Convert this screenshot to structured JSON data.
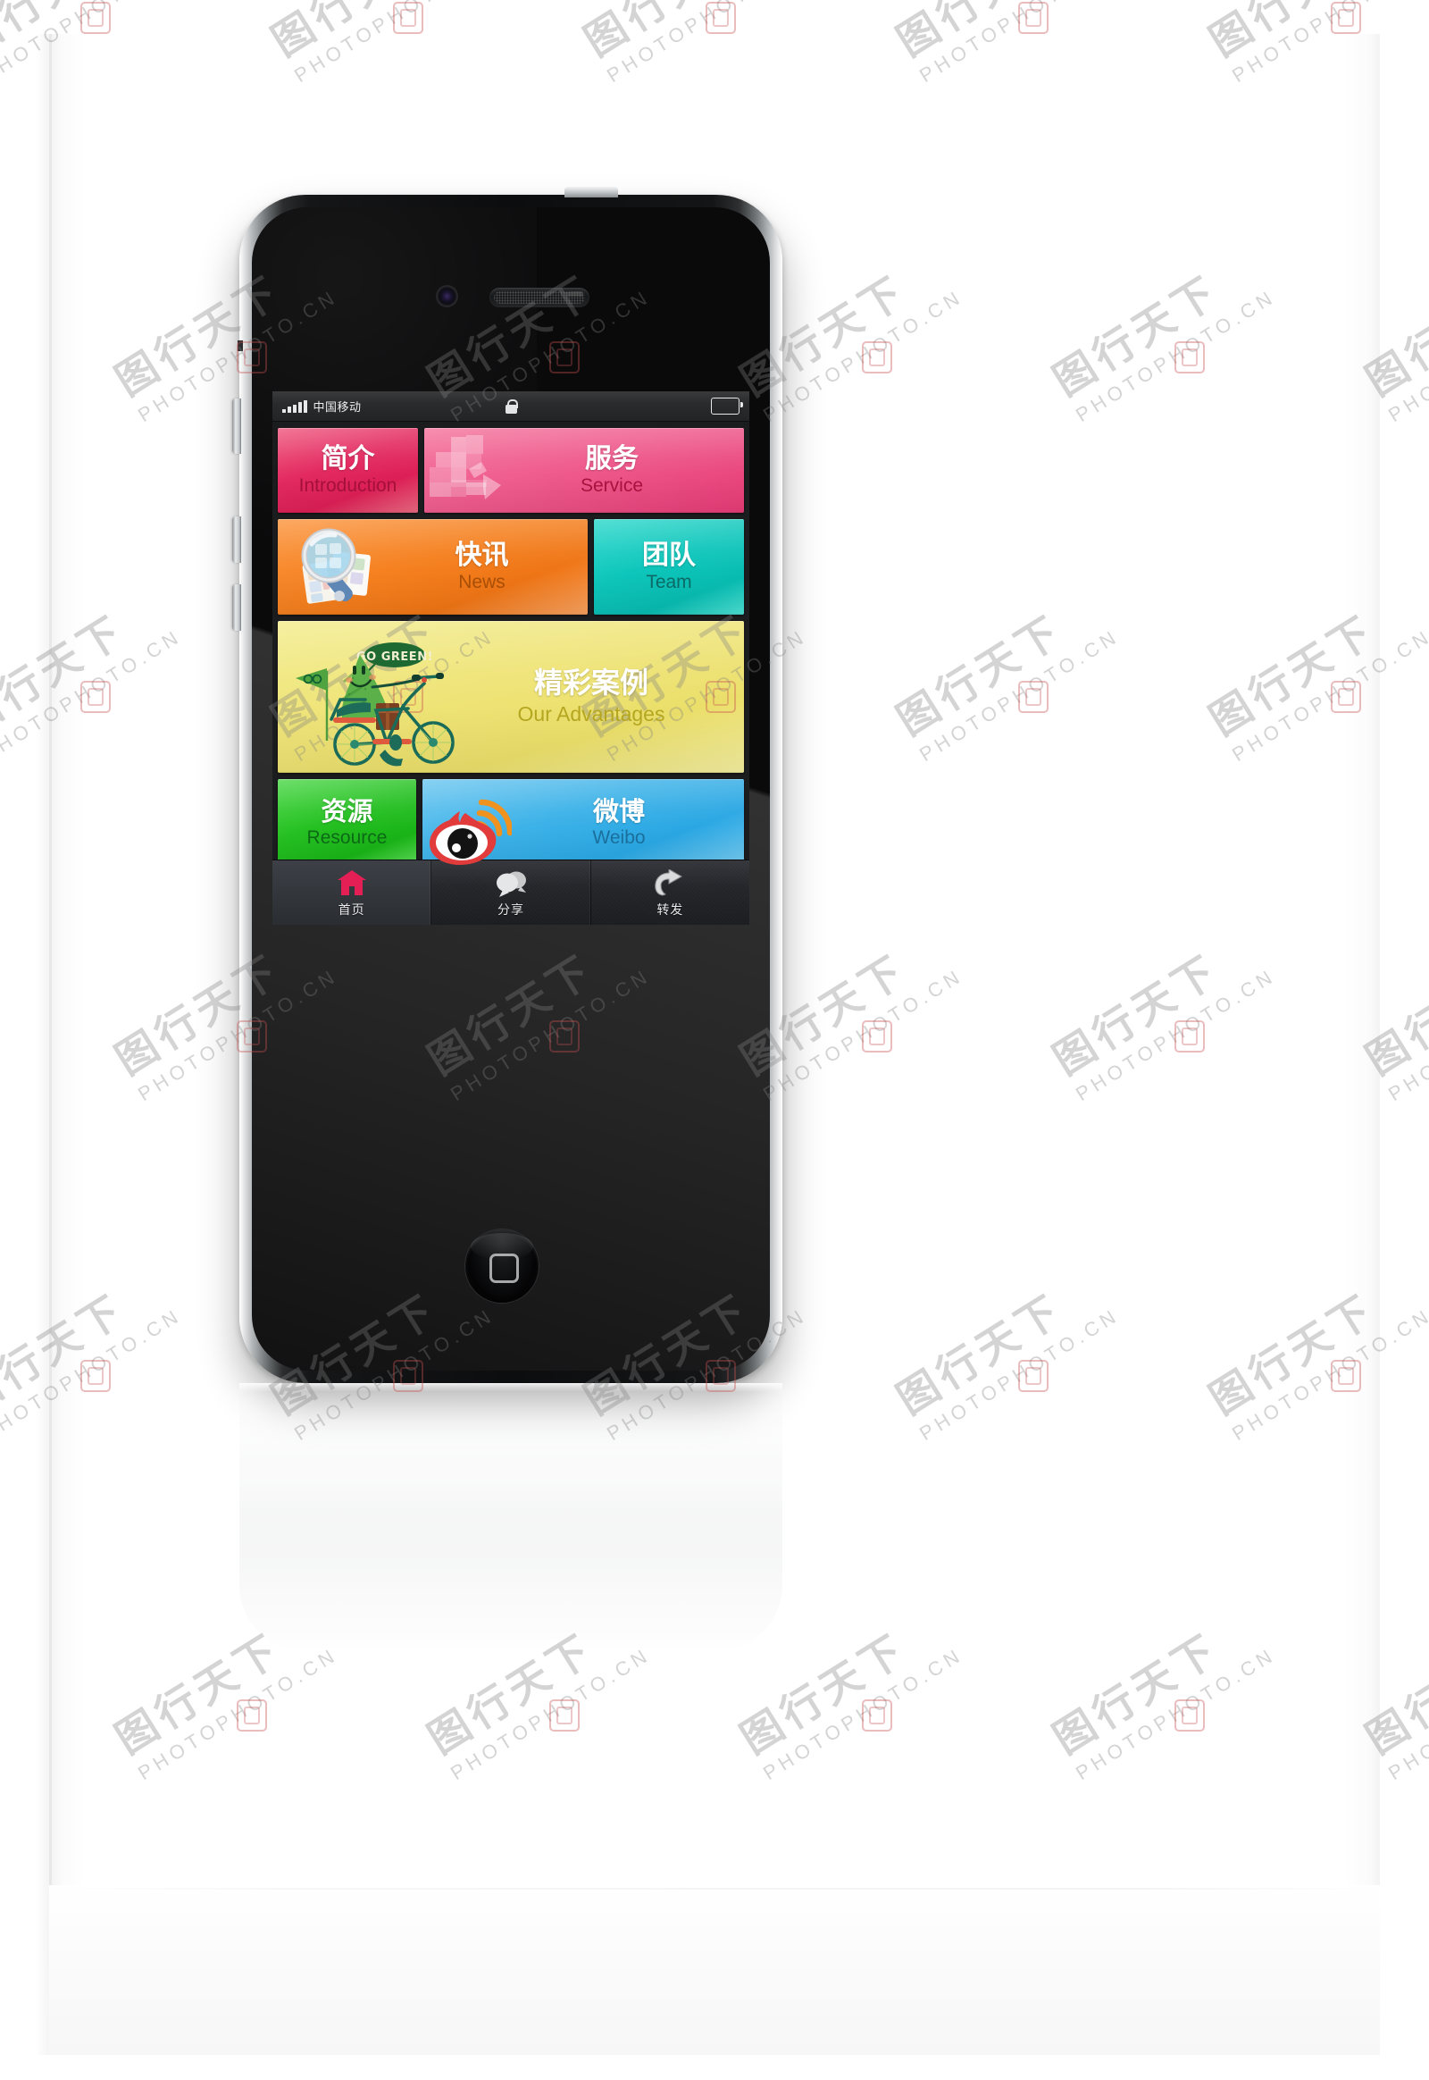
{
  "device": {
    "type": "smartphone-mockup",
    "model_style": "iphone-4-black",
    "hardware": {
      "camera": "front-camera",
      "speaker": "earpiece-speaker",
      "home_button": "home-button",
      "power_button": "power-button",
      "mute_switch": "mute-switch",
      "volume_up": "volume-up-button",
      "volume_down": "volume-down-button"
    }
  },
  "statusbar": {
    "signal_icon": "signal-bars-icon",
    "signal_bars": 5,
    "carrier": "中国移动",
    "center_icon": "lock-icon",
    "battery_icon": "battery-icon",
    "battery_level": "full"
  },
  "tiles": [
    {
      "id": "introduction",
      "title_cn": "简介",
      "title_en": "Introduction",
      "color": "#e32a60",
      "text_color": "#ffffff",
      "sub_color": "#a4103a",
      "icon": null
    },
    {
      "id": "service",
      "title_cn": "服务",
      "title_en": "Service",
      "color": "#ef5b8d",
      "text_color": "#ffffff",
      "sub_color": "#a8123f",
      "icon": "pixel-mosaic-arrow-icon"
    },
    {
      "id": "news",
      "title_cn": "快讯",
      "title_en": "News",
      "color": "#f5801f",
      "text_color": "#ffffff",
      "sub_color": "#a84e07",
      "icon": "magnifier-over-swatches-icon"
    },
    {
      "id": "team",
      "title_cn": "团队",
      "title_en": "Team",
      "color": "#0ec6bb",
      "text_color": "#ffffff",
      "sub_color": "#0b6a66",
      "icon": null
    },
    {
      "id": "our-advantages",
      "title_cn": "精彩案例",
      "title_en": "Our Advantages",
      "color": "#efe478",
      "text_color": "#ffffff",
      "sub_color": "#b5a621",
      "icon": "go-green-tree-on-bicycle-illustration",
      "illustration_text": "GO GREEN!"
    },
    {
      "id": "resource",
      "title_cn": "资源",
      "title_en": "Resource",
      "color": "#25c022",
      "text_color": "#ffffff",
      "sub_color": "#0c6a15",
      "icon": null
    },
    {
      "id": "weibo",
      "title_cn": "微博",
      "title_en": "Weibo",
      "color": "#3cb2e8",
      "text_color": "#ffffff",
      "sub_color": "#1a6f9c",
      "icon": "sina-weibo-eye-icon"
    }
  ],
  "tabbar": {
    "items": [
      {
        "id": "home",
        "label": "首页",
        "icon": "house-icon",
        "icon_color": "#e31f56",
        "active": true
      },
      {
        "id": "share",
        "label": "分享",
        "icon": "speech-bubbles-icon",
        "icon_color": "#d9dadc",
        "active": false
      },
      {
        "id": "forward",
        "label": "转发",
        "icon": "redo-arrow-icon",
        "icon_color": "#d9dadc",
        "active": false
      }
    ]
  },
  "watermark": {
    "cjk": "图行天下",
    "latin": "PHOTOPHOTO.CN"
  }
}
